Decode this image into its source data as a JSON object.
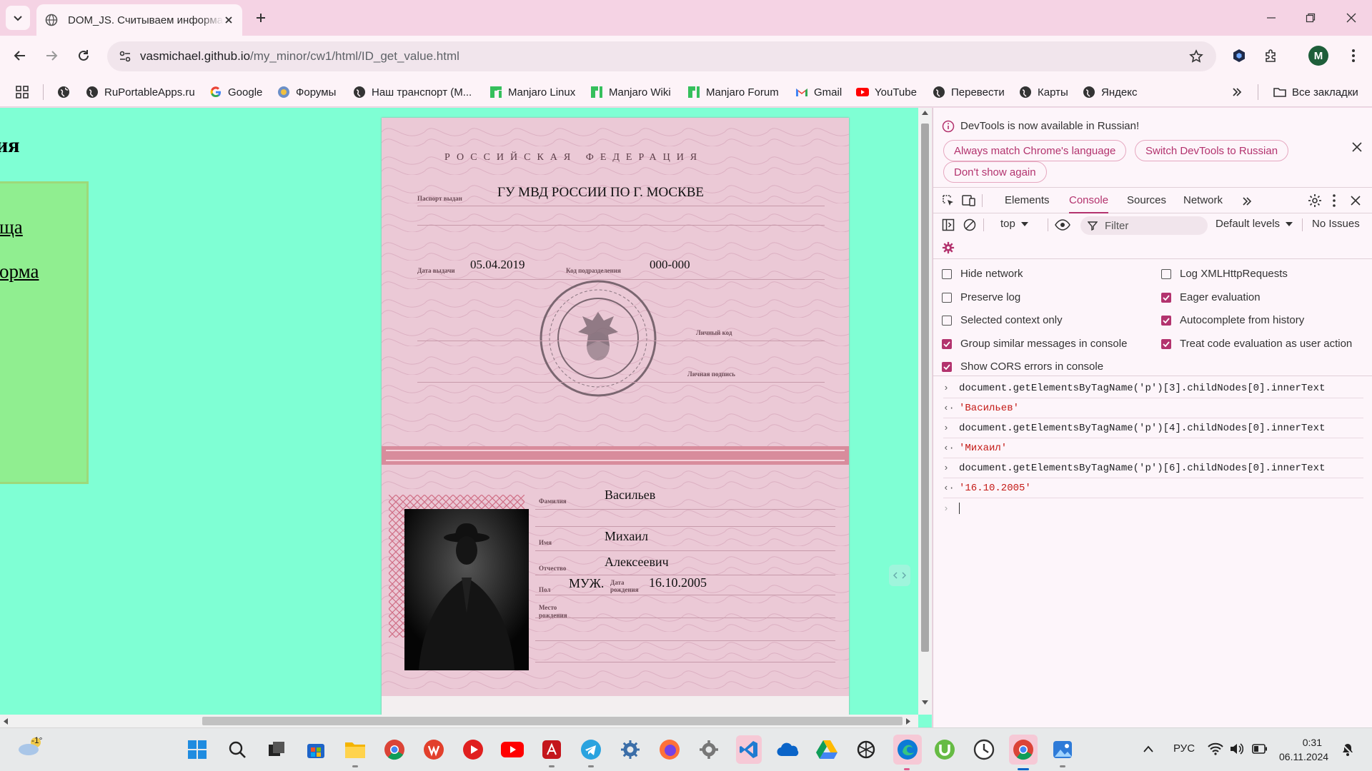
{
  "browser": {
    "tab_title": "DOM_JS. Считываем информацию",
    "url_host": "vasmichael.github.io",
    "url_path": "/my_minor/cw1/html/ID_get_value.html",
    "profile_initial": "M"
  },
  "bookmarks": {
    "items": [
      "RuPortableApps.ru",
      "Google",
      "Форумы",
      "Наш транспорт (М...",
      "Manjaro Linux",
      "Manjaro Wiki",
      "Manjaro Forum",
      "Gmail",
      "YouTube",
      "Перевести",
      "Карты",
      "Яндекс"
    ],
    "all_label": "Все закладки"
  },
  "page": {
    "heading": "ия",
    "link1": "ща",
    "link2": "орма"
  },
  "passport": {
    "header": "РОССИЙСКАЯ ФЕДЕРАЦИЯ",
    "issued_by_label": "Паспорт выдан",
    "issued_by": "ГУ МВД РОССИИ ПО Г. МОСКВЕ",
    "issue_date_label": "Дата выдачи",
    "issue_date": "05.04.2019",
    "code_label": "Код подразделения",
    "code": "000-000",
    "personal_code_label": "Личный код",
    "signature_label": "Личная подпись",
    "surname_label": "Фамилия",
    "surname": "Васильев",
    "name_label": "Имя",
    "name": "Михаил",
    "patronymic_label": "Отчество",
    "patronymic": "Алексеевич",
    "sex_label": "Пол",
    "sex": "МУЖ.",
    "dob_label": "Дата рождения",
    "dob": "16.10.2005",
    "birthplace_label": "Место рождения"
  },
  "devtools": {
    "banner": "DevTools is now available in Russian!",
    "pill_match": "Always match Chrome's language",
    "pill_switch": "Switch DevTools to Russian",
    "pill_dont": "Don't show again",
    "tabs": [
      "Elements",
      "Console",
      "Sources",
      "Network"
    ],
    "active_tab": "Console",
    "context": "top",
    "filter_placeholder": "Filter",
    "levels": "Default levels",
    "issues": "No Issues",
    "settings_left": [
      {
        "label": "Hide network",
        "checked": false
      },
      {
        "label": "Preserve log",
        "checked": false
      },
      {
        "label": "Selected context only",
        "checked": false
      },
      {
        "label": "Group similar messages in console",
        "checked": true
      },
      {
        "label": "Show CORS errors in console",
        "checked": true
      }
    ],
    "settings_right": [
      {
        "label": "Log XMLHttpRequests",
        "checked": false
      },
      {
        "label": "Eager evaluation",
        "checked": true
      },
      {
        "label": "Autocomplete from history",
        "checked": true
      },
      {
        "label": "Treat code evaluation as user action",
        "checked": true
      }
    ],
    "console": [
      {
        "input": "document.getElementsByTagName('p')[3].childNodes[0].innerText",
        "output": "'Васильев'"
      },
      {
        "input": "document.getElementsByTagName('p')[4].childNodes[0].innerText",
        "output": "'Михаил'"
      },
      {
        "input": "document.getElementsByTagName('p')[6].childNodes[0].innerText",
        "output": "'16.10.2005'"
      }
    ]
  },
  "taskbar": {
    "weather": "-1°",
    "lang": "РУС",
    "time": "0:31",
    "date": "06.11.2024"
  }
}
